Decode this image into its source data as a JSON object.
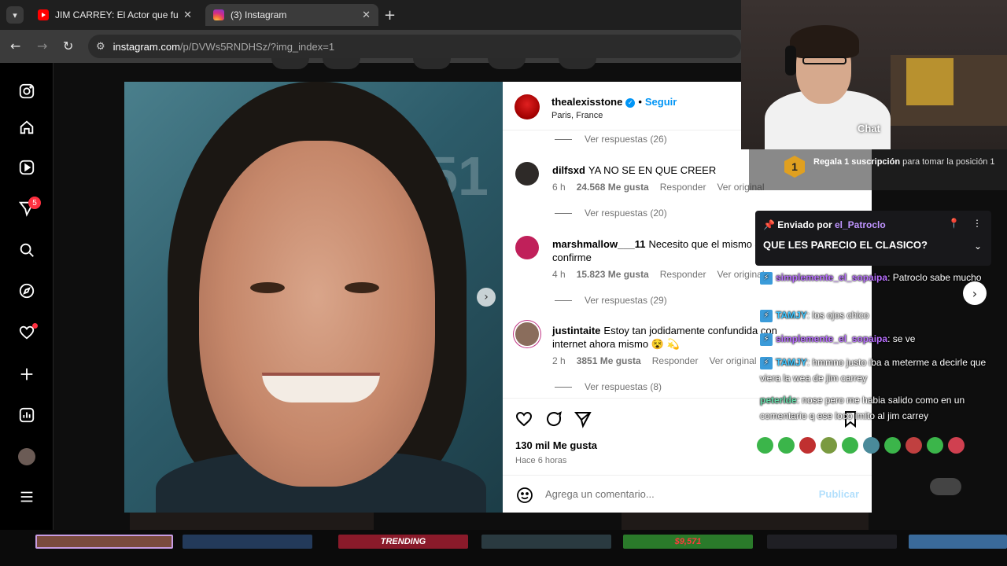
{
  "browser": {
    "tabs": [
      {
        "title": "JIM CARREY: El Actor que fue R",
        "active": false
      },
      {
        "title": "(3) Instagram",
        "active": true
      }
    ],
    "url_host": "instagram.com",
    "url_path": "/p/DVWs5RNDHSz/?img_index=1"
  },
  "sidebar": {
    "items": [
      "instagram-logo",
      "home",
      "reels",
      "messages",
      "search",
      "explore",
      "notifications",
      "create",
      "dashboard",
      "profile",
      "more"
    ],
    "notification_count": "5"
  },
  "post": {
    "username": "thealexisstone",
    "follow_label": "Seguir",
    "location": "Paris, France",
    "photo_watermark": "51",
    "likes": "130 mil Me gusta",
    "time": "Hace 6 horas",
    "comment_placeholder": "Agrega un comentario...",
    "publish_label": "Publicar",
    "comments": [
      {
        "user": "dilfsxd",
        "text": "YA NO SE EN QUE CREER",
        "time": "6 h",
        "likes": "24.568 Me gusta",
        "reply": "Responder",
        "original": "Ver original",
        "replies": "Ver respuestas (20)"
      },
      {
        "user": "marshmallow___11",
        "text": "Necesito que el mismo J confirme",
        "time": "4 h",
        "likes": "15.823 Me gusta",
        "reply": "Responder",
        "original": "Ver original",
        "replies": "Ver respuestas (29)"
      },
      {
        "user": "justintaite",
        "text": "Estoy tan jodidamente confundida con internet ahora mismo 😵 💫",
        "time": "2 h",
        "likes": "3851 Me gusta",
        "reply": "Responder",
        "original": "Ver original",
        "replies": "Ver respuestas (8)"
      }
    ],
    "top_replies": "Ver respuestas (26)"
  },
  "webcam": {
    "label": "Chat"
  },
  "chat": {
    "gift_rank": "1",
    "gift_text_bold": "Regala 1 suscripción",
    "gift_text": "para tomar la posición 1",
    "pinned_label": "Enviado por",
    "pinned_by": "el_Patroclo",
    "pinned_message": "QUE LES PARECIO EL CLASICO?",
    "messages": [
      {
        "user": "simplemente_el_sopaipa",
        "text": ": Patroclo sabe mucho"
      },
      {
        "user": "TAMJY",
        "text": ": los ojos chico"
      },
      {
        "user": "simplemente_el_sopaipa",
        "text": ": se ve"
      },
      {
        "user": "TAMJY",
        "text": ": hmmno justo iba a meterme a decirle que viera la wea de jim carrey"
      },
      {
        "user": "peterlde",
        "text": ": nose pero me habia salido como en un comentario q ese loco imito al jim carrey"
      }
    ]
  },
  "taskbar": {
    "thumbs": [
      "",
      "",
      "TRENDING",
      "",
      "$9,571",
      ""
    ]
  },
  "colors": {
    "instagram_blue": "#0095f6",
    "twitch_purple": "#bf94ff",
    "notification_red": "#ff3040"
  }
}
